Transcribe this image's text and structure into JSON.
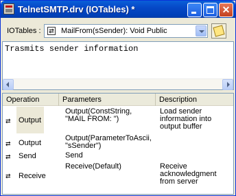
{
  "window": {
    "title": "TelnetSMTP.drv (IOTables)  *"
  },
  "iotables": {
    "label": "IOTables :",
    "selected": "MailFrom(sSender): Void Public"
  },
  "description": {
    "text": "Trasmits sender information"
  },
  "table": {
    "headers": [
      "Operation",
      "Parameters",
      "Description"
    ],
    "rows": [
      {
        "operation": "Output",
        "parameters": "Output(ConstString, \"MAIL FROM: \")",
        "description": "Load sender information into output buffer"
      },
      {
        "operation": "Output",
        "parameters": "Output(ParameterToAscii, \"sSender\")",
        "description": ""
      },
      {
        "operation": "Send",
        "parameters": "Send",
        "description": ""
      },
      {
        "operation": "Receive",
        "parameters": "Receive(Default)",
        "description": "Receive acknowledgment from server"
      }
    ]
  },
  "icons": {
    "app": "driver-icon",
    "combo": "method-icon",
    "notes": "notes-icon",
    "row_arrow": "⇄"
  },
  "colors": {
    "titlebar": "#0a5fd8",
    "window_bg": "#ece9d8",
    "close_button": "#c2401f"
  }
}
